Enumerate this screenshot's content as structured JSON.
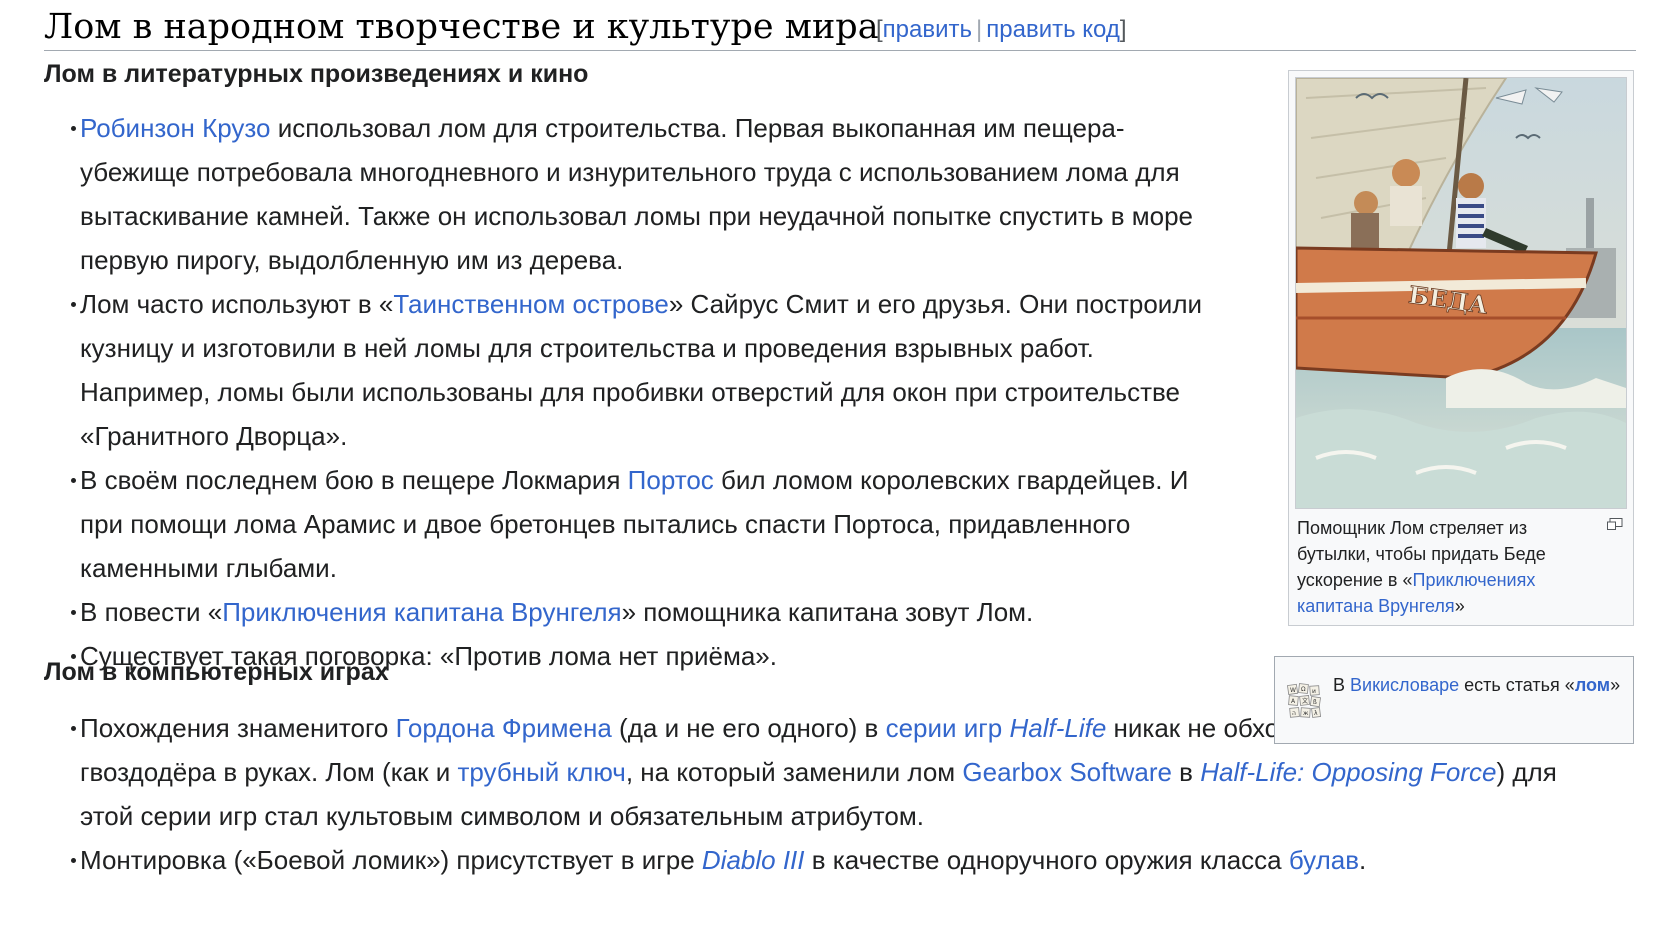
{
  "heading": {
    "title": "Лом в народном творчестве и культуре мира",
    "bracket_open": "[",
    "edit": "править",
    "separator": "|",
    "edit_code": "править код",
    "bracket_close": "]"
  },
  "section_lit": {
    "title": "Лом в литературных произведениях и кино",
    "items": [
      {
        "link1": "Робинзон Крузо",
        "text1": " использовал лом для строительства. Первая выкопанная им пещера-убежище потребовала многодневного и изнурительного труда с использованием лома для вытаскивание камней. Также он использовал ломы при неудачной попытке спустить в море первую пирогу, выдолбленную им из дерева."
      },
      {
        "text1": "Лом часто используют в «",
        "link1": "Таинственном острове",
        "text2": "» Сайрус Смит и его друзья. Они построили кузницу и изготовили в ней ломы для строительства и проведения взрывных работ. Например, ломы были использованы для пробивки отверстий для окон при строительстве «Гранитного Дворца»."
      },
      {
        "text1": "В своём последнем бою в пещере Локмария ",
        "link1": "Портос",
        "text2": " бил ломом королевских гвардейцев. И при помощи лома Арамис и двое бретонцев пытались спасти Портоса, придавленного каменными глыбами."
      },
      {
        "text1": "В повести «",
        "link1": "Приключения капитана Врунгеля",
        "text2": "» помощника капитана зовут Лом."
      },
      {
        "text1": "Существует такая поговорка: «Против лома нет приёма»."
      }
    ]
  },
  "section_games": {
    "title": "Лом в компьютерных играх",
    "items": [
      {
        "text1": "Похождения знаменитого ",
        "link1": "Гордона Фримена",
        "text2": " (да и не его одного) в ",
        "link2": "серии игр ",
        "link2_italic": "Half-Life",
        "text3": " никак не обходятся без ломика-гвоздодёра в руках. Лом (как и ",
        "link3": "трубный ключ",
        "text4": ", на который заменили лом ",
        "link4": "Gearbox Software",
        "text5": " в ",
        "link5": "Half-Life: Opposing Force",
        "text6": ") для этой серии игр стал культовым символом и обязательным атрибутом."
      },
      {
        "text1": "Монтировка («Боевой ломик») присутствует в игре ",
        "link1": "Diablo III",
        "text2": " в качестве одноручного оружия класса ",
        "link2": "булав",
        "text3": "."
      }
    ]
  },
  "thumb": {
    "boat_name": "БЕДА",
    "caption_text": "Помощник Лом стреляет из бутылки, чтобы придать Беде ускорение в «",
    "caption_link": "Приключениях капитана Врунгеля",
    "caption_end": "»",
    "icon": "magnify-clip-icon"
  },
  "wiktionary": {
    "text1": "В ",
    "link1": "Викисловаре",
    "text2": " есть статья «",
    "link2": "лом",
    "text3": "»",
    "icon": "wiktionary-logo"
  },
  "colors": {
    "link": "#3366cc",
    "text": "#202122",
    "border": "#a2a9b1",
    "box_bg": "#f8f9fa"
  }
}
